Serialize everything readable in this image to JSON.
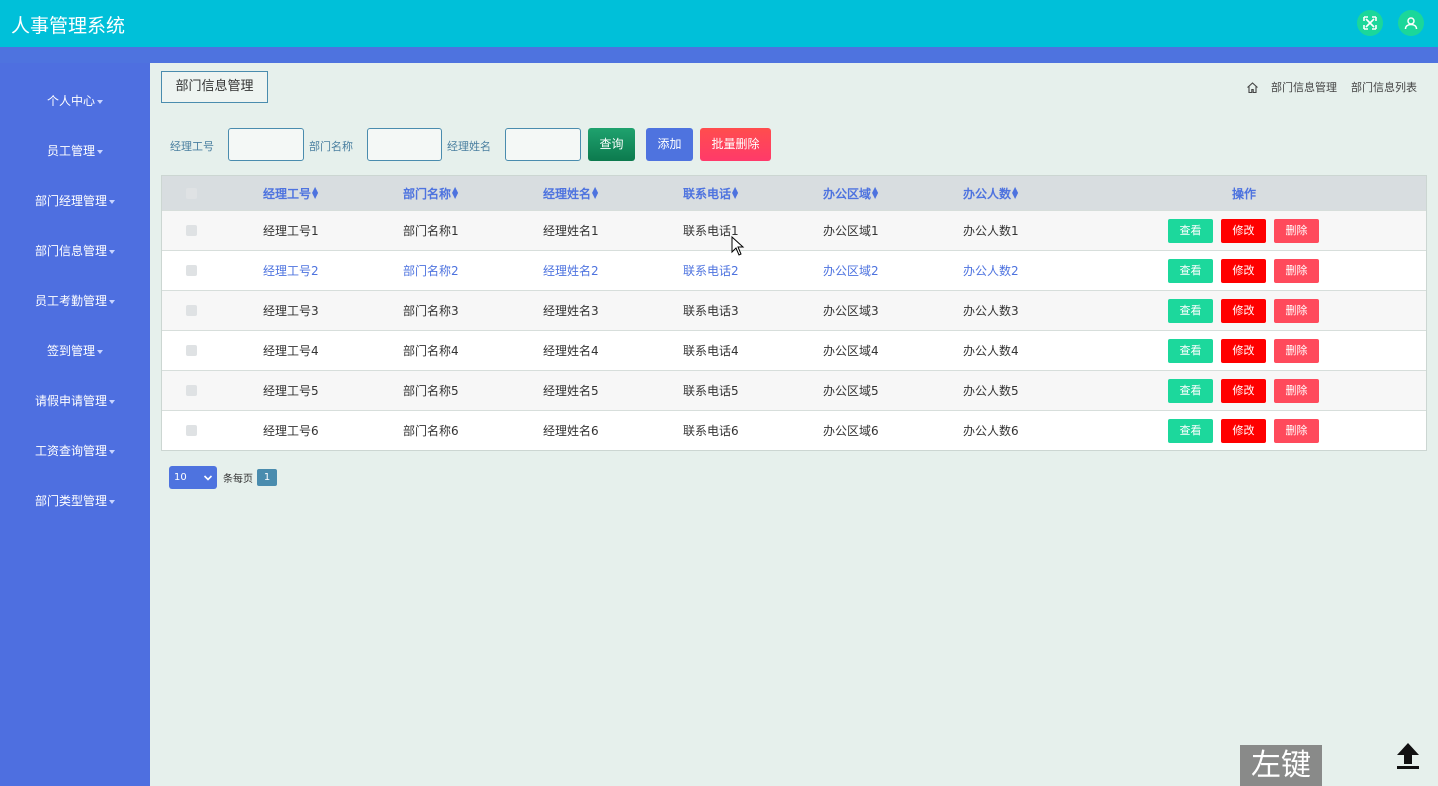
{
  "app": {
    "title": "人事管理系统"
  },
  "header": {
    "icons": [
      "fullscreen-icon",
      "user-icon"
    ],
    "accent": "#00c0d9"
  },
  "sidebar": {
    "items": [
      {
        "label": "个人中心"
      },
      {
        "label": "员工管理"
      },
      {
        "label": "部门经理管理"
      },
      {
        "label": "部门信息管理"
      },
      {
        "label": "员工考勤管理"
      },
      {
        "label": "签到管理"
      },
      {
        "label": "请假申请管理"
      },
      {
        "label": "工资查询管理"
      },
      {
        "label": "部门类型管理"
      }
    ]
  },
  "page": {
    "tab_label": "部门信息管理",
    "breadcrumb": [
      "部门信息管理",
      "部门信息列表"
    ]
  },
  "search": {
    "fields": [
      {
        "label": "经理工号",
        "value": ""
      },
      {
        "label": "部门名称",
        "value": ""
      },
      {
        "label": "经理姓名",
        "value": ""
      }
    ],
    "query_label": "查询",
    "add_label": "添加",
    "batch_delete_label": "批量删除"
  },
  "table": {
    "columns": [
      "经理工号",
      "部门名称",
      "经理姓名",
      "联系电话",
      "办公区域",
      "办公人数"
    ],
    "action_header": "操作",
    "rows": [
      [
        "经理工号1",
        "部门名称1",
        "经理姓名1",
        "联系电话1",
        "办公区域1",
        "办公人数1"
      ],
      [
        "经理工号2",
        "部门名称2",
        "经理姓名2",
        "联系电话2",
        "办公区域2",
        "办公人数2"
      ],
      [
        "经理工号3",
        "部门名称3",
        "经理姓名3",
        "联系电话3",
        "办公区域3",
        "办公人数3"
      ],
      [
        "经理工号4",
        "部门名称4",
        "经理姓名4",
        "联系电话4",
        "办公区域4",
        "办公人数4"
      ],
      [
        "经理工号5",
        "部门名称5",
        "经理姓名5",
        "联系电话5",
        "办公区域5",
        "办公人数5"
      ],
      [
        "经理工号6",
        "部门名称6",
        "经理姓名6",
        "联系电话6",
        "办公区域6",
        "办公人数6"
      ]
    ],
    "actions": {
      "view": "查看",
      "edit": "修改",
      "delete": "删除"
    }
  },
  "pagination": {
    "page_size": "10",
    "per_page_label": "条每页",
    "current_page": "1"
  },
  "overlay": {
    "key_hint": "左键"
  }
}
